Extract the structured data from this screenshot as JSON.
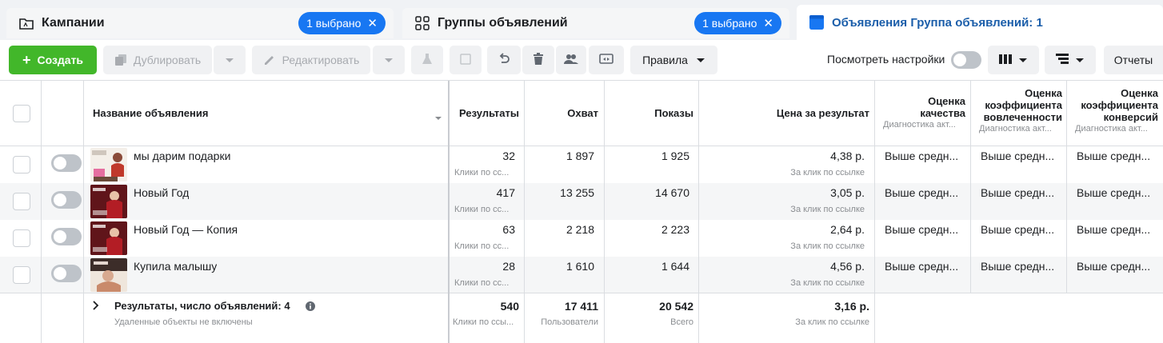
{
  "tabs": {
    "campaigns": {
      "label": "Кампании",
      "selected": "1 выбрано"
    },
    "adsets": {
      "label": "Группы объявлений",
      "selected": "1 выбрано"
    },
    "ads": {
      "label": "Объявления Группа объявлений: 1"
    }
  },
  "toolbar": {
    "create": "Создать",
    "duplicate": "Дублировать",
    "edit": "Редактировать",
    "rules": "Правила",
    "view_settings": "Посмотреть настройки",
    "reports": "Отчеты"
  },
  "columns": {
    "name": "Название объявления",
    "results": "Результаты",
    "reach": "Охват",
    "impressions": "Показы",
    "cost": "Цена за результат",
    "quality": "Оценка качества",
    "quality_sub": "Диагностика акт...",
    "engagement_a": "Оценка",
    "engagement_b": "коэффициента",
    "engagement_c": "вовлеченности",
    "engagement_sub": "Диагностика акт...",
    "conversion_a": "Оценка",
    "conversion_b": "коэффициента",
    "conversion_c": "конверсий",
    "conversion_sub": "Диагностика акт..."
  },
  "rows": [
    {
      "name": "мы дарим подарки",
      "results": "32",
      "results_sub": "Клики по сс...",
      "reach": "1 897",
      "impressions": "1 925",
      "cost": "4,38 р.",
      "cost_sub": "За клик по ссылке",
      "quality": "Выше средн...",
      "engagement": "Выше средн...",
      "conversion": "Выше средн..."
    },
    {
      "name": "Новый Год",
      "results": "417",
      "results_sub": "Клики по сс...",
      "reach": "13 255",
      "impressions": "14 670",
      "cost": "3,05 р.",
      "cost_sub": "За клик по ссылке",
      "quality": "Выше средн...",
      "engagement": "Выше средн...",
      "conversion": "Выше средн..."
    },
    {
      "name": "Новый Год — Копия",
      "results": "63",
      "results_sub": "Клики по сс...",
      "reach": "2 218",
      "impressions": "2 223",
      "cost": "2,64 р.",
      "cost_sub": "За клик по ссылке",
      "quality": "Выше средн...",
      "engagement": "Выше средн...",
      "conversion": "Выше средн..."
    },
    {
      "name": "Купила малышу",
      "results": "28",
      "results_sub": "Клики по сс...",
      "reach": "1 610",
      "impressions": "1 644",
      "cost": "4,56 р.",
      "cost_sub": "За клик по ссылке",
      "quality": "Выше средн...",
      "engagement": "Выше средн...",
      "conversion": "Выше средн..."
    }
  ],
  "summary": {
    "label": "Результаты, число объявлений: 4",
    "note": "Удаленные объекты не включены",
    "results": "540",
    "results_sub": "Клики по ссы...",
    "reach": "17 411",
    "reach_sub": "Пользователи",
    "impressions": "20 542",
    "impressions_sub": "Всего",
    "cost": "3,16 р.",
    "cost_sub": "За клик по ссылке"
  },
  "colors": {
    "primary": "#1877f2",
    "create_green": "#42b72a",
    "active_tab_text": "#1b5eaa"
  }
}
